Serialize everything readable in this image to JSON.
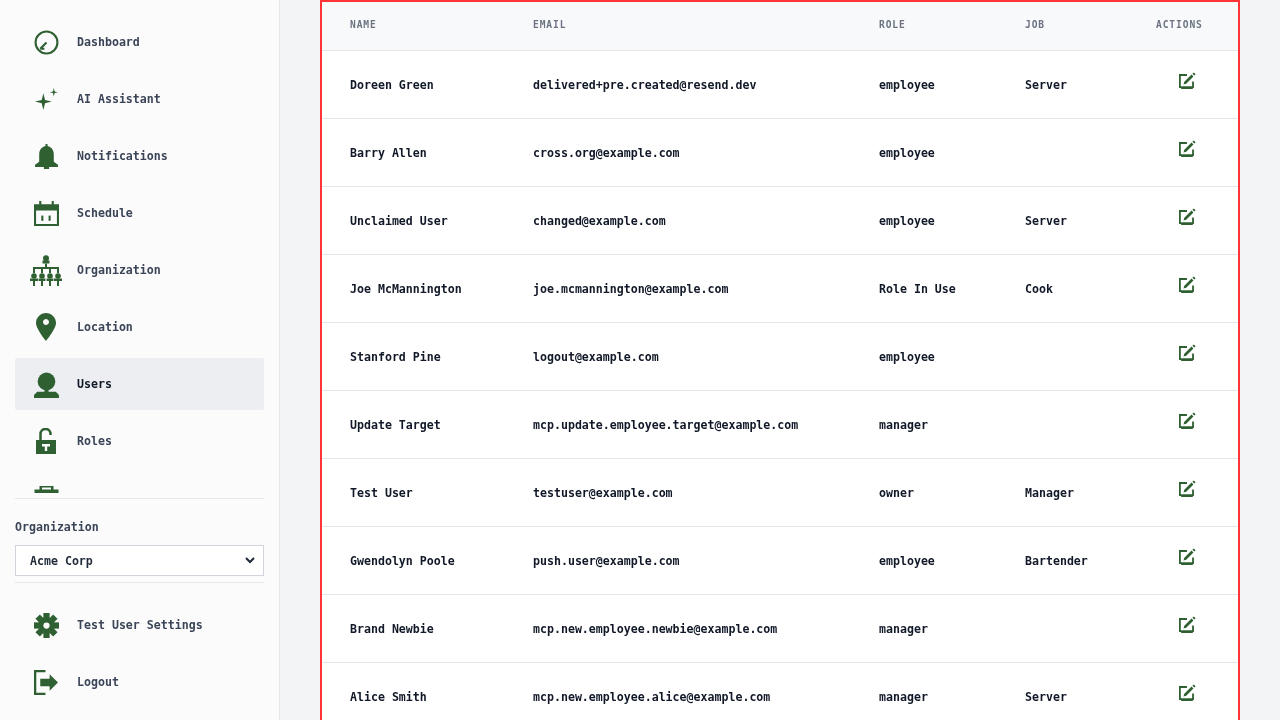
{
  "sidebar": {
    "nav_items": [
      {
        "label": "Dashboard",
        "selected": false
      },
      {
        "label": "AI Assistant",
        "selected": false
      },
      {
        "label": "Notifications",
        "selected": false
      },
      {
        "label": "Schedule",
        "selected": false
      },
      {
        "label": "Organization",
        "selected": false
      },
      {
        "label": "Location",
        "selected": false
      },
      {
        "label": "Users",
        "selected": true
      },
      {
        "label": "Roles",
        "selected": false
      },
      {
        "selected": false
      }
    ],
    "organization": {
      "label": "Organization",
      "value": "Acme Corp"
    },
    "footer_items": [
      {
        "label": "Test User Settings"
      },
      {
        "label": "Logout"
      }
    ]
  },
  "table": {
    "columns": [
      "NAME",
      "EMAIL",
      "ROLE",
      "JOB",
      "ACTIONS"
    ],
    "rows": [
      {
        "name": "Doreen Green",
        "email": "delivered+pre.created@resend.dev",
        "role": "employee",
        "job": "Server"
      },
      {
        "name": "Barry Allen",
        "email": "cross.org@example.com",
        "role": "employee"
      },
      {
        "name": "Unclaimed User",
        "email": "changed@example.com",
        "role": "employee",
        "job": "Server"
      },
      {
        "name": "Joe McMannington",
        "email": "joe.mcmannington@example.com",
        "role": "Role In Use",
        "job": "Cook"
      },
      {
        "name": "Stanford Pine",
        "email": "logout@example.com",
        "role": "employee"
      },
      {
        "name": "Update Target",
        "email": "mcp.update.employee.target@example.com",
        "role": "manager"
      },
      {
        "name": "Test User",
        "email": "testuser@example.com",
        "role": "owner",
        "job": "Manager"
      },
      {
        "name": "Gwendolyn Poole",
        "email": "push.user@example.com",
        "role": "employee",
        "job": "Bartender"
      },
      {
        "name": "Brand Newbie",
        "email": "mcp.new.employee.newbie@example.com",
        "role": "manager"
      },
      {
        "name": "Alice Smith",
        "email": "mcp.new.employee.alice@example.com",
        "role": "manager",
        "job": "Server"
      }
    ]
  }
}
